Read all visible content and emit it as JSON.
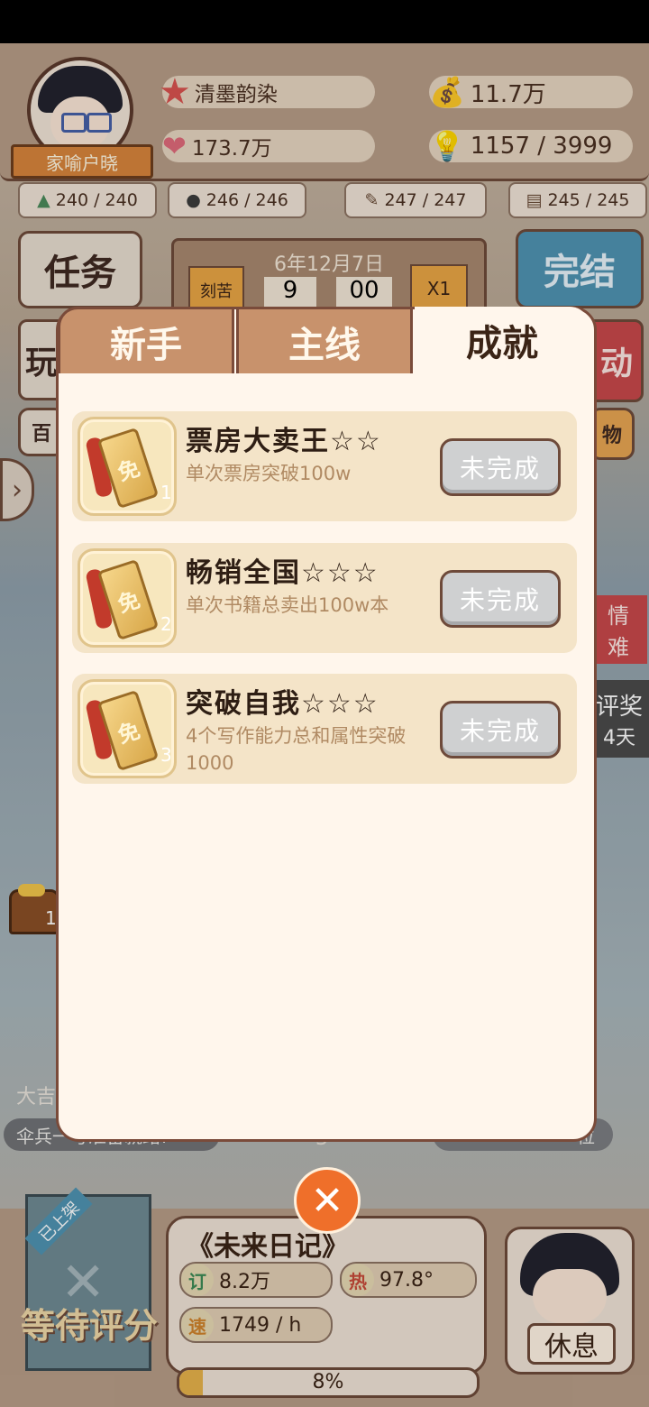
{
  "player": {
    "name": "家喻户晓",
    "title": "清墨韵染",
    "fans": "173.7万",
    "money": "11.7万",
    "idea": "1157 / 3999"
  },
  "stats": [
    "240 / 240",
    "246 / 246",
    "247 / 247",
    "245 / 245"
  ],
  "side_buttons": {
    "task": "任务",
    "finish": "完结",
    "play": "玩",
    "activity": "动",
    "hundred": "百",
    "shop": "物"
  },
  "calendar": {
    "date": "6年12月7日",
    "effort": "刻苦",
    "hour": "9",
    "minute": "00",
    "speed": "X1"
  },
  "background_text": {
    "lucky": "大吉",
    "news": "伞兵一号准备就绪!",
    "rank": "3",
    "position": "位",
    "love": "情",
    "hard": "难",
    "award": "评奖",
    "days": "4天",
    "chest_count": "1"
  },
  "tabs": [
    {
      "label": "新手"
    },
    {
      "label": "主线"
    },
    {
      "label": "成就"
    }
  ],
  "achievements": [
    {
      "index": "1",
      "name": "票房大卖王☆☆",
      "desc": "单次票房突破100w",
      "status": "未完成",
      "icon_char": "免"
    },
    {
      "index": "2",
      "name": "畅销全国☆☆☆",
      "desc": "单次书籍总卖出100w本",
      "status": "未完成",
      "icon_char": "免"
    },
    {
      "index": "3",
      "name": "突破自我☆☆☆",
      "desc": "4个写作能力总和属性突破1000",
      "status": "未完成",
      "icon_char": "免"
    }
  ],
  "close_icon": "close-icon",
  "book": {
    "cover_badge": "已上架",
    "cover_status": "等待评分",
    "title": "《未来日记》",
    "orders_label": "订",
    "orders": "8.2万",
    "heat_label": "热",
    "heat": "97.8°",
    "speed_label": "速",
    "speed": "1749 / h",
    "progress": "8%",
    "progress_value": 0.08
  },
  "rest_button": "休息",
  "colors": {
    "accent": "#ef6f2a",
    "tab_inactive": "#c8926c",
    "card_bg": "#f4e4c8",
    "status_btn": "#cfd0d1"
  }
}
